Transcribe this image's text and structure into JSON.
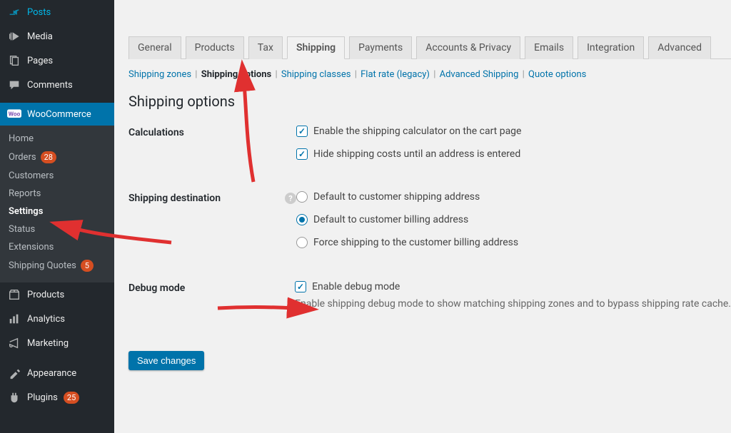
{
  "sidebar": {
    "top_items": [
      {
        "label": "Posts",
        "icon": "pin"
      },
      {
        "label": "Media",
        "icon": "media"
      },
      {
        "label": "Pages",
        "icon": "pages"
      },
      {
        "label": "Comments",
        "icon": "comment"
      }
    ],
    "woo_label": "WooCommerce",
    "woo_submenu": [
      {
        "label": "Home"
      },
      {
        "label": "Orders",
        "badge": "28"
      },
      {
        "label": "Customers"
      },
      {
        "label": "Reports"
      },
      {
        "label": "Settings",
        "active": true
      },
      {
        "label": "Status"
      },
      {
        "label": "Extensions"
      },
      {
        "label": "Shipping Quotes",
        "badge": "5"
      }
    ],
    "bottom_items": [
      {
        "label": "Products",
        "icon": "products"
      },
      {
        "label": "Analytics",
        "icon": "analytics"
      },
      {
        "label": "Marketing",
        "icon": "marketing"
      },
      {
        "label": "Appearance",
        "icon": "appearance"
      },
      {
        "label": "Plugins",
        "icon": "plugins",
        "badge": "25"
      }
    ]
  },
  "tabs": [
    {
      "label": "General"
    },
    {
      "label": "Products"
    },
    {
      "label": "Tax"
    },
    {
      "label": "Shipping",
      "active": true
    },
    {
      "label": "Payments"
    },
    {
      "label": "Accounts & Privacy"
    },
    {
      "label": "Emails"
    },
    {
      "label": "Integration"
    },
    {
      "label": "Advanced"
    }
  ],
  "subtabs": [
    {
      "label": "Shipping zones"
    },
    {
      "label": "Shipping options",
      "active": true
    },
    {
      "label": "Shipping classes"
    },
    {
      "label": "Flat rate (legacy)"
    },
    {
      "label": "Advanced Shipping"
    },
    {
      "label": "Quote options"
    }
  ],
  "section_title": "Shipping options",
  "calculations": {
    "label": "Calculations",
    "opt1": "Enable the shipping calculator on the cart page",
    "opt2": "Hide shipping costs until an address is entered"
  },
  "destination": {
    "label": "Shipping destination",
    "opt1": "Default to customer shipping address",
    "opt2": "Default to customer billing address",
    "opt3": "Force shipping to the customer billing address",
    "selected": 1
  },
  "debug": {
    "label": "Debug mode",
    "opt": "Enable debug mode",
    "desc": "Enable shipping debug mode to show matching shipping zones and to bypass shipping rate cache."
  },
  "save_label": "Save changes"
}
